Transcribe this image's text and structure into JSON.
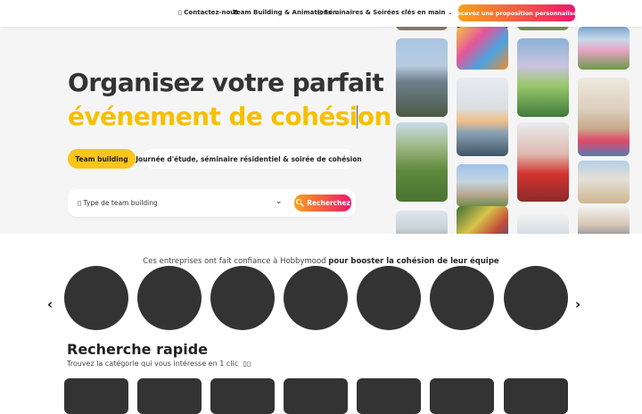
{
  "nav": {
    "contact": "Contactez-nous",
    "team_building": "Team Building & Animations",
    "seminaires": "Séminaires & Soirées clés en main",
    "cta": "Recevez une proposition personnalisée"
  },
  "hero": {
    "title_line1": "Organisez votre parfait",
    "title_line2": "événement de cohésion",
    "pill_active": "Team building",
    "pill_other": "Journée d'étude, séminaire résidentiel & soirée de cohésion",
    "search_placeholder": "Type de team building",
    "search_button": "Recherchez"
  },
  "trust": {
    "prefix": "Ces entreprises ont fait confiance à Hobbymood ",
    "bold": "pour booster la cohésion de leur équipe"
  },
  "quick_search": {
    "title": "Recherche rapide",
    "subtitle": "Trouvez la catégorie qui vous intéresse en 1 clic"
  },
  "colors": {
    "accent_yellow": "#fbc51a",
    "title_yellow": "#f5c000",
    "gradient_start": "#f7a21b",
    "gradient_end": "#f0166d"
  }
}
